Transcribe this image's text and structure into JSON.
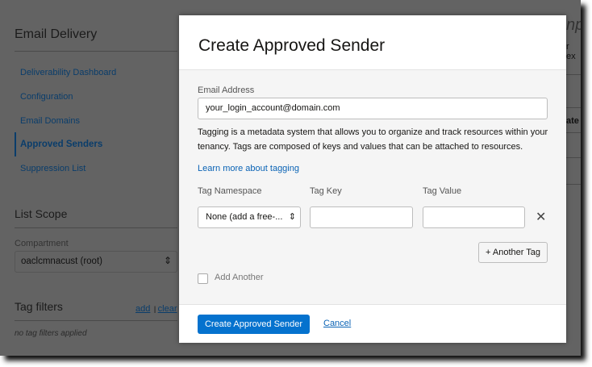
{
  "sidebar": {
    "title": "Email Delivery",
    "nav": [
      "Deliverability Dashboard",
      "Configuration",
      "Email Domains",
      "Approved Senders",
      "Suppression List"
    ],
    "active": "Approved Senders",
    "list_scope": "List Scope",
    "compartment_label": "Compartment",
    "compartment_value": "oaclcmnacust (root)",
    "tag_filters": "Tag filters",
    "add": "add",
    "clear": "clear",
    "no_filters": "no tag filters applied"
  },
  "background_fragments": [
    "np",
    "r ex",
    "ate"
  ],
  "modal": {
    "title": "Create Approved Sender",
    "email_label": "Email Address",
    "email_value": "your_login_account@domain.com",
    "tagging_text": "Tagging is a metadata system that allows you to organize and track resources within your tenancy. Tags are composed of keys and values that can be attached to resources.",
    "learn_more": "Learn more about tagging",
    "tag_namespace_label": "Tag Namespace",
    "tag_key_label": "Tag Key",
    "tag_value_label": "Tag Value",
    "tag_namespace_value": "None (add a free-...",
    "tag_key_value": "",
    "tag_value_value": "",
    "another_tag": "+ Another Tag",
    "add_another": "Add Another",
    "submit": "Create Approved Sender",
    "cancel": "Cancel"
  }
}
